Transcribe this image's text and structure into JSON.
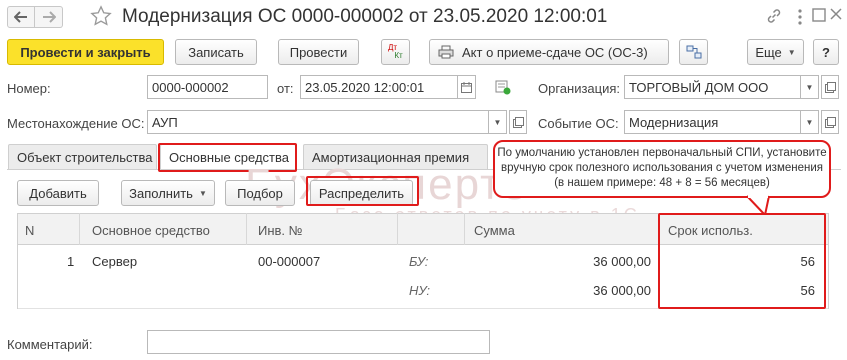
{
  "title": "Модернизация ОС 0000-000002 от 23.05.2020 12:00:01",
  "toolbar": {
    "post_and_close": "Провести и закрыть",
    "save": "Записать",
    "post": "Провести",
    "dtkt_top": "Дт",
    "dtkt_bottom": "Кт",
    "act": "Акт о приеме-сдаче ОС (ОС-3)",
    "more": "Еще",
    "help": "?"
  },
  "header_fields": {
    "number_label": "Номер:",
    "number_value": "0000-000002",
    "date_label": "от:",
    "date_value": "23.05.2020 12:00:01",
    "org_label": "Организация:",
    "org_value": "ТОРГОВЫЙ ДОМ ООО",
    "location_label": "Местонахождение ОС:",
    "location_value": "АУП",
    "event_label": "Событие ОС:",
    "event_value": "Модернизация"
  },
  "tabs": [
    {
      "label": "Объект строительства"
    },
    {
      "label": "Основные средства"
    },
    {
      "label": "Амортизационная премия"
    }
  ],
  "table_toolbar": {
    "add": "Добавить",
    "fill": "Заполнить",
    "select": "Подбор",
    "distribute": "Распределить"
  },
  "callout": {
    "line1": "По умолчанию установлен первоначальный СПИ, установите",
    "line2": "вручную срок полезного использования с учетом изменения",
    "line3": "(в нашем примере: 48 + 8 = 56 месяцев)"
  },
  "watermark": {
    "main": "БухЭксперт8",
    "sub": "База ответов по учету в 1С"
  },
  "table": {
    "columns": [
      "N",
      "Основное средство",
      "Инв. №",
      "Сумма",
      "Срок использ."
    ],
    "rows": [
      {
        "n": "1",
        "asset": "Сервер",
        "inv": "00-000007",
        "label_bu": "БУ:",
        "label_nu": "НУ:",
        "sum_bu": "36 000,00",
        "sum_nu": "36 000,00",
        "term_bu": "56",
        "term_nu": "56"
      }
    ]
  },
  "comment": {
    "label": "Комментарий:",
    "value": ""
  },
  "colors": {
    "accent_yellow": "#fbe12a",
    "highlight_red": "#e01b1b"
  }
}
